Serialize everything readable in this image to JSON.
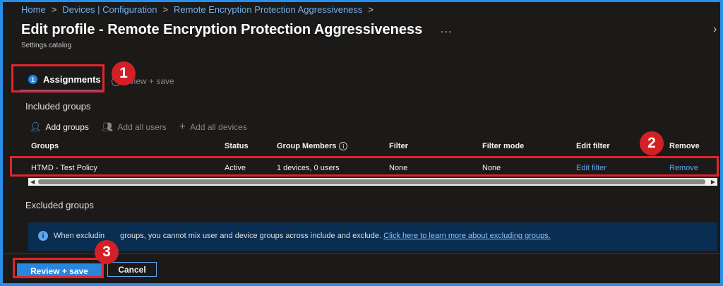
{
  "breadcrumb": {
    "items": [
      "Home",
      "Devices | Configuration",
      "Remote Encryption Protection Aggressiveness"
    ],
    "separator": ">"
  },
  "header": {
    "title": "Edit profile - Remote Encryption Protection Aggressiveness",
    "subtitle": "Settings catalog",
    "more": "..."
  },
  "tabs": [
    {
      "step": "1",
      "label": "Assignments",
      "active": true
    },
    {
      "step": "2",
      "label": "Review + save",
      "active": false,
      "visible_label": "eview + save"
    }
  ],
  "included_groups": {
    "heading": "Included groups",
    "commands": [
      {
        "icon": "person-add-icon",
        "label": "Add groups",
        "enabled": true
      },
      {
        "icon": "people-icon",
        "label": "Add all users",
        "enabled": false
      },
      {
        "icon": "plus-icon",
        "label": "Add all devices",
        "enabled": false
      }
    ],
    "columns": [
      "Groups",
      "Status",
      "Group Members",
      "Filter",
      "Filter mode",
      "Edit filter",
      "Remove"
    ],
    "rows": [
      {
        "group": "HTMD - Test Policy",
        "status": "Active",
        "members": "1 devices, 0 users",
        "filter": "None",
        "filter_mode": "None",
        "edit_filter": "Edit filter",
        "remove": "Remove"
      }
    ]
  },
  "excluded_groups": {
    "heading": "Excluded groups",
    "info_text_before": "When excludin",
    "info_text_after": "groups, you cannot mix user and device groups across include and exclude.",
    "info_link": "Click here to learn more about excluding groups."
  },
  "footer": {
    "primary_label": "Review + save",
    "secondary_label": "Cancel"
  },
  "annotations": {
    "badges": [
      "1",
      "2",
      "3"
    ],
    "color": "#e3242b"
  },
  "colors": {
    "accent": "#2886de",
    "link": "#5ea6f0",
    "background": "#1b1a19",
    "border_outer": "#2a8ee8"
  }
}
